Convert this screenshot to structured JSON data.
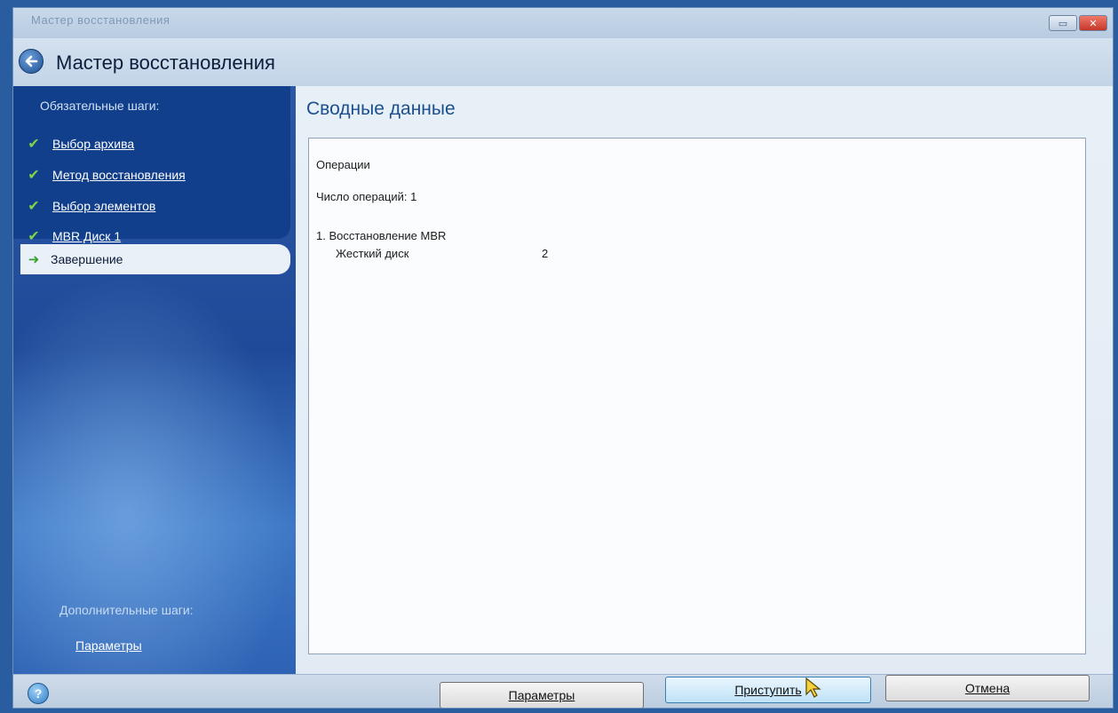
{
  "window": {
    "caption": "Мастер восстановления",
    "header_title": "Мастер восстановления"
  },
  "sidebar": {
    "required_heading": "Обязательные шаги:",
    "steps": [
      {
        "label": "Выбор архива",
        "status": "done"
      },
      {
        "label": "Метод восстановления",
        "status": "done"
      },
      {
        "label": "Выбор элементов",
        "status": "done"
      },
      {
        "label": "MBR Диск 1",
        "status": "done"
      }
    ],
    "current_step": "Завершение",
    "extra_heading": "Дополнительные шаги:",
    "extra_link": "Параметры"
  },
  "main": {
    "title": "Сводные данные",
    "summary": {
      "section": "Операции",
      "count_line": "Число операций: 1",
      "operation": "1. Восстановление MBR",
      "disk_label": "Жесткий диск",
      "disk_value": "2"
    }
  },
  "footer": {
    "help_label": "?",
    "params_button": "Параметры",
    "proceed_button": "Приступить",
    "cancel_button": "Отмена"
  },
  "colors": {
    "sidebar": "#1f4a99",
    "accent_title": "#1b4f8f",
    "check": "#7fd34a"
  }
}
